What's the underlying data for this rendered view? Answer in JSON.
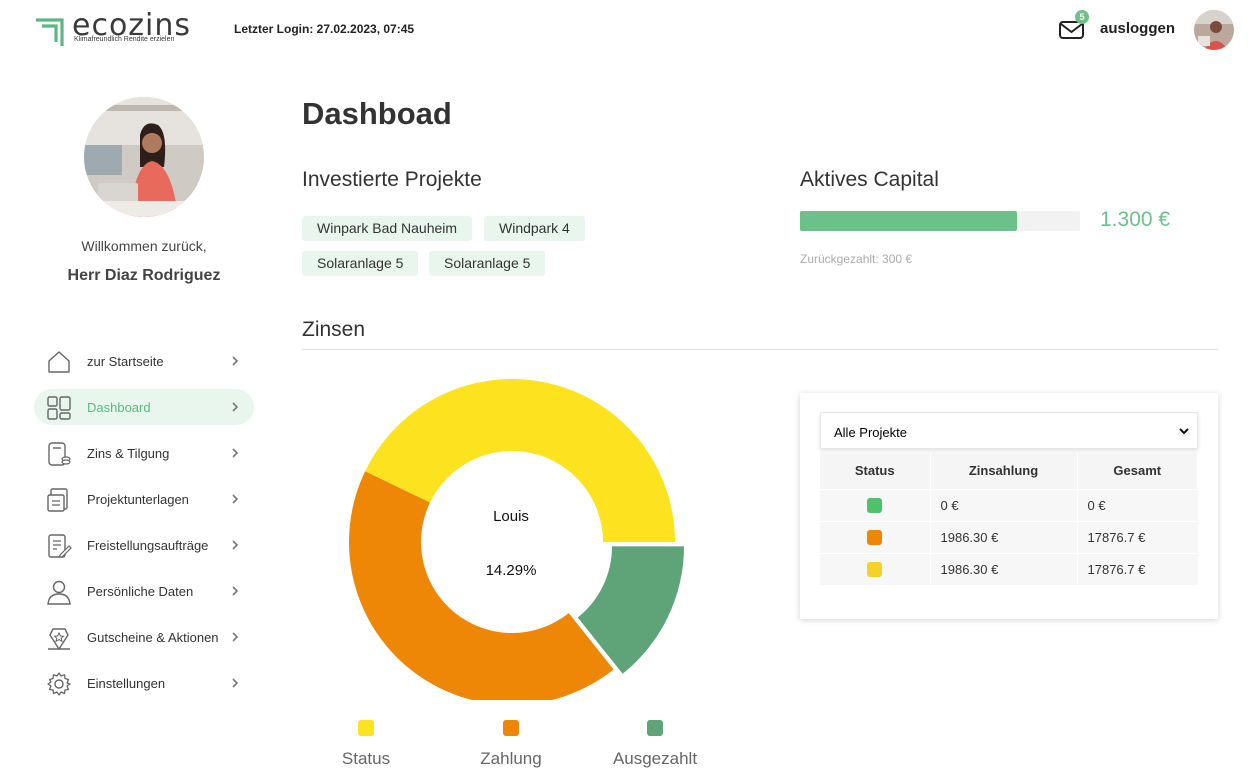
{
  "header": {
    "logo_text": "ecozins",
    "logo_tagline": "Klimafreundlich Rendite erzielen",
    "last_login": "Letzter Login: 27.02.2023, 07:45",
    "mail_badge": "5",
    "logout_label": "ausloggen"
  },
  "sidebar": {
    "welcome": "Willkommen zurück,",
    "user_name": "Herr Diaz Rodriguez",
    "items": [
      {
        "label": "zur Startseite",
        "icon": "home-icon"
      },
      {
        "label": "Dashboard",
        "icon": "dashboard-icon",
        "active": true
      },
      {
        "label": "Zins & Tilgung",
        "icon": "coins-icon"
      },
      {
        "label": "Projektunterlagen",
        "icon": "documents-icon"
      },
      {
        "label": "Freistellungsaufträge",
        "icon": "edit-document-icon"
      },
      {
        "label": "Persönliche Daten",
        "icon": "user-icon"
      },
      {
        "label": "Gutscheine & Aktionen",
        "icon": "voucher-icon"
      },
      {
        "label": "Einstellungen",
        "icon": "gear-icon"
      }
    ]
  },
  "main": {
    "title": "Dashboad",
    "projects_title": "Investierte Projekte",
    "projects": [
      "Winpark Bad Nauheim",
      "Windpark 4",
      "Solaranlage 5",
      "Solaranlage 5"
    ],
    "capital_title": "Aktives Capital",
    "capital_progress": 0.775,
    "capital_amount": "1.300 €",
    "repaid": "Zurückgezahlt: 300 €",
    "zinsen_title": "Zinsen"
  },
  "donut": {
    "center_name": "Louis",
    "center_percent": "14.29%",
    "segments": [
      {
        "label": "Status",
        "value": 42.86,
        "color": "#fde31f"
      },
      {
        "label": "Zahlung",
        "value": 42.86,
        "color": "#ef8706"
      },
      {
        "label": "Ausgezahlt",
        "value": 14.29,
        "color": "#5ea478"
      }
    ]
  },
  "table": {
    "filter_value": "Alle Projekte",
    "headers": [
      "Status",
      "Zinsahlung",
      "Gesamt"
    ],
    "rows": [
      {
        "status_color": "#4fc168",
        "zins": "0 €",
        "gesamt": "0 €"
      },
      {
        "status_color": "#ef8706",
        "zins": "1986.30 €",
        "gesamt": "17876.7 €"
      },
      {
        "status_color": "#f5d22a",
        "zins": "1986.30 €",
        "gesamt": "17876.7 €"
      }
    ]
  },
  "colors": {
    "accent": "#6cc18a",
    "tag_bg": "#e9f6ee"
  }
}
